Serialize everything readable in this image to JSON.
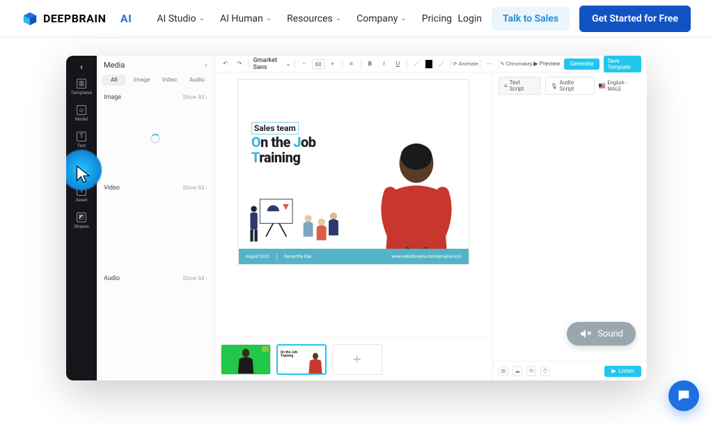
{
  "brand": {
    "name": "DEEPBRAIN",
    "suffix": "AI"
  },
  "nav": {
    "items": [
      {
        "label": "AI Studio"
      },
      {
        "label": "AI Human"
      },
      {
        "label": "Resources"
      },
      {
        "label": "Company"
      }
    ],
    "pricing": "Pricing",
    "login": "Login",
    "talk": "Talk to Sales",
    "cta": "Get Started for Free"
  },
  "rail": {
    "templates": "Templates",
    "model": "Model",
    "text": "Text",
    "asset": "Asset",
    "shapes": "Shapes"
  },
  "media": {
    "title": "Media",
    "tabs": {
      "all": "All",
      "image": "Image",
      "video": "Video",
      "audio": "Audio"
    },
    "sections": {
      "image": "Image",
      "video": "Video",
      "audio": "Audio",
      "showall": "Show All ›"
    }
  },
  "toolbar": {
    "font": "Gmarket Sans",
    "size": "60",
    "animate": "Animate",
    "chromakey": "Chromakey",
    "preview": "Preview",
    "generate": "Generate",
    "save": "Save Template"
  },
  "slide": {
    "small": "Sales team",
    "line1_pre": "O",
    "line1_rest": "n the ",
    "line1_j": "J",
    "line1_end": "ob",
    "line2_t": "T",
    "line2_rest": "raining",
    "footer_date": "August 2023",
    "footer_name": "Samantha Doe",
    "footer_url": "www.websitename.domainname.com"
  },
  "thumbs": {
    "t2_line1": "On the Job",
    "t2_line2": "Training"
  },
  "script": {
    "text_tab": "Text Script",
    "audio_tab": "Audio Script",
    "lang": "English - MALE",
    "listen": "Listen"
  },
  "sound": "Sound"
}
